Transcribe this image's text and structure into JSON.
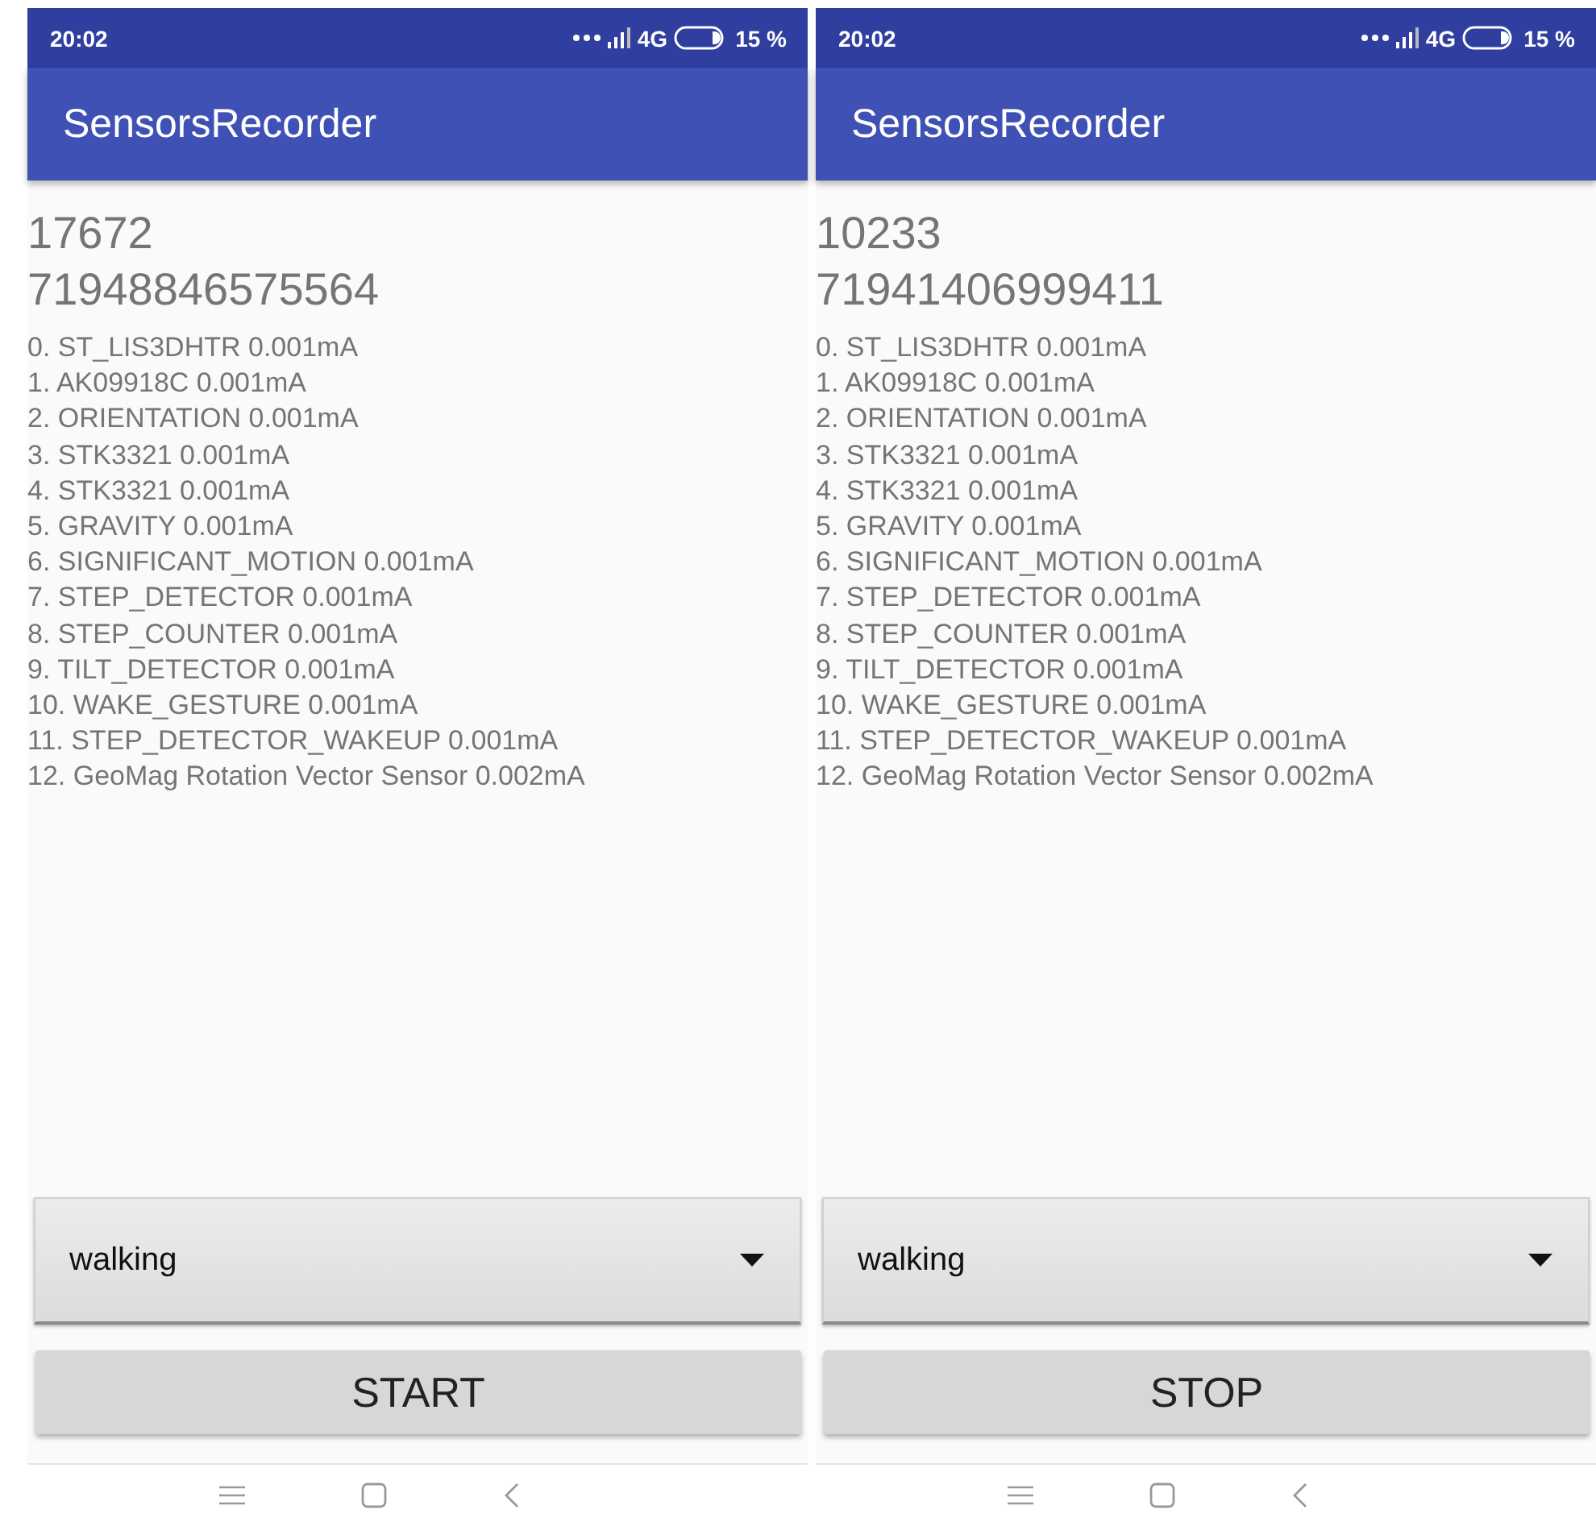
{
  "screens": [
    {
      "status_bar": {
        "time": "20:02",
        "network": "4G",
        "battery": "15 %"
      },
      "title": "SensorsRecorder",
      "counter": "17672",
      "timestamp": "71948846575564",
      "sensors": [
        "0. ST_LIS3DHTR 0.001mA",
        "1. AK09918C 0.001mA",
        "2. ORIENTATION 0.001mA",
        "3. STK3321 0.001mA",
        "4. STK3321 0.001mA",
        "5. GRAVITY 0.001mA",
        "6. SIGNIFICANT_MOTION 0.001mA",
        "7. STEP_DETECTOR 0.001mA",
        "8. STEP_COUNTER 0.001mA",
        "9. TILT_DETECTOR 0.001mA",
        "10. WAKE_GESTURE 0.001mA",
        "11. STEP_DETECTOR_WAKEUP 0.001mA",
        "12. GeoMag Rotation Vector Sensor 0.002mA"
      ],
      "activity": {
        "value": "walking"
      },
      "button": {
        "label": "START"
      }
    },
    {
      "status_bar": {
        "time": "20:02",
        "network": "4G",
        "battery": "15 %"
      },
      "title": "SensorsRecorder",
      "counter": "10233",
      "timestamp": "71941406999411",
      "sensors": [
        "0. ST_LIS3DHTR 0.001mA",
        "1. AK09918C 0.001mA",
        "2. ORIENTATION 0.001mA",
        "3. STK3321 0.001mA",
        "4. STK3321 0.001mA",
        "5. GRAVITY 0.001mA",
        "6. SIGNIFICANT_MOTION 0.001mA",
        "7. STEP_DETECTOR 0.001mA",
        "8. STEP_COUNTER 0.001mA",
        "9. TILT_DETECTOR 0.001mA",
        "10. WAKE_GESTURE 0.001mA",
        "11. STEP_DETECTOR_WAKEUP 0.001mA",
        "12. GeoMag Rotation Vector Sensor 0.002mA"
      ],
      "activity": {
        "value": "walking"
      },
      "button": {
        "label": "STOP"
      }
    }
  ]
}
